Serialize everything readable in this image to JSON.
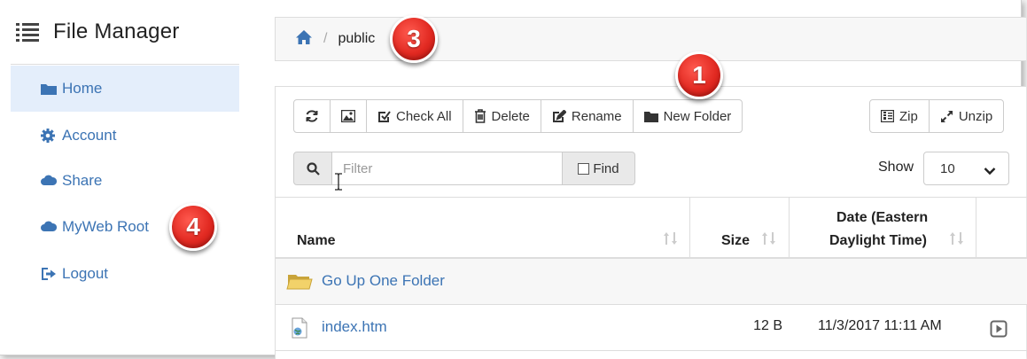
{
  "app": {
    "title": "File Manager"
  },
  "sidebar": {
    "items": [
      {
        "label": "Home",
        "icon": "folder-icon",
        "active": true
      },
      {
        "label": "Account",
        "icon": "gear-icon"
      },
      {
        "label": "Share",
        "icon": "cloud-icon"
      },
      {
        "label": "MyWeb Root",
        "icon": "cloud-icon"
      },
      {
        "label": "Logout",
        "icon": "logout-icon"
      }
    ]
  },
  "breadcrumb": {
    "home_icon": "home-icon",
    "separator": "/",
    "current": "public"
  },
  "toolbar": {
    "refresh_icon": "refresh-icon",
    "image_icon": "image-icon",
    "check_all": "Check All",
    "delete": "Delete",
    "rename": "Rename",
    "new_folder": "New Folder",
    "zip": "Zip",
    "unzip": "Unzip"
  },
  "filter": {
    "placeholder": "Filter",
    "value": "",
    "find_label": "Find"
  },
  "show": {
    "label": "Show",
    "selected": "10"
  },
  "table": {
    "headers": {
      "name": "Name",
      "size": "Size",
      "date_line1": "Date (Eastern",
      "date_line2": "Daylight Time)"
    },
    "rows": [
      {
        "name": "Go Up One Folder",
        "size": "",
        "date": "",
        "icon": "folder-up-icon"
      },
      {
        "name": "index.htm",
        "size": "12 B",
        "date": "11/3/2017 11:11 AM",
        "icon": "html-file-icon"
      }
    ]
  },
  "callouts": [
    "1",
    "3",
    "4"
  ],
  "colors": {
    "link": "#3c74b4",
    "active_bg": "#e4eefb",
    "badge": "#e22a22"
  }
}
